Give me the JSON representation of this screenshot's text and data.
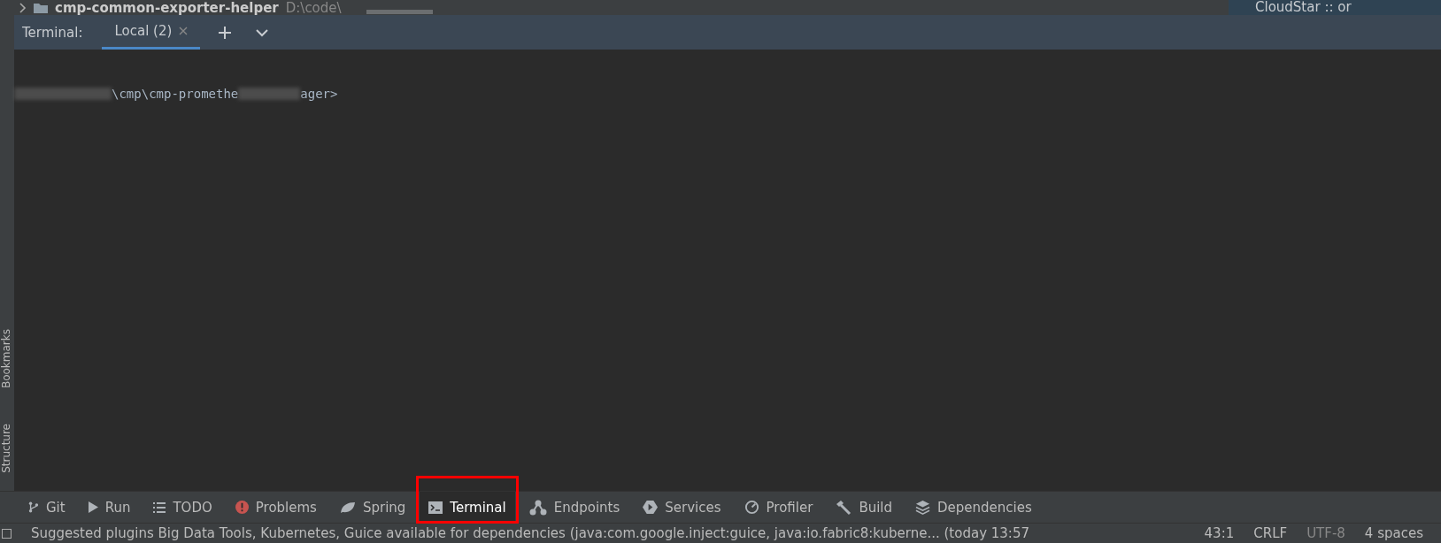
{
  "project_tree": {
    "name": "cmp-common-exporter-helper",
    "path": "D:\\code\\",
    "right_item": "CloudStar :: or"
  },
  "left_stripe": [
    {
      "label": "Bookmarks"
    },
    {
      "label": "Structure"
    }
  ],
  "terminal": {
    "title": "Terminal:",
    "tabs": [
      {
        "label": "Local (2)",
        "selected": true
      }
    ],
    "prompt_start": "\\cmp\\cmp-promethe",
    "prompt_end": "ager>"
  },
  "tool_windows": [
    {
      "label": "Git",
      "kind": "git",
      "selected": false
    },
    {
      "label": "Run",
      "kind": "run",
      "selected": false
    },
    {
      "label": "TODO",
      "kind": "list",
      "selected": false
    },
    {
      "label": "Problems",
      "kind": "problems",
      "selected": false
    },
    {
      "label": "Spring",
      "kind": "leaf",
      "selected": false
    },
    {
      "label": "Terminal",
      "kind": "terminal",
      "selected": true
    },
    {
      "label": "Endpoints",
      "kind": "endpoints",
      "selected": false
    },
    {
      "label": "Services",
      "kind": "services",
      "selected": false
    },
    {
      "label": "Profiler",
      "kind": "profiler",
      "selected": false
    },
    {
      "label": "Build",
      "kind": "build",
      "selected": false
    },
    {
      "label": "Dependencies",
      "kind": "layers",
      "selected": false
    }
  ],
  "status_bar": {
    "message": "Suggested plugins Big Data Tools, Kubernetes, Guice available for dependencies (java:com.google.inject:guice, java:io.fabric8:kuberne... (today 13:57",
    "position": "43:1",
    "line_separator": "CRLF",
    "encoding": "UTF-8",
    "indent": "4 spaces"
  }
}
